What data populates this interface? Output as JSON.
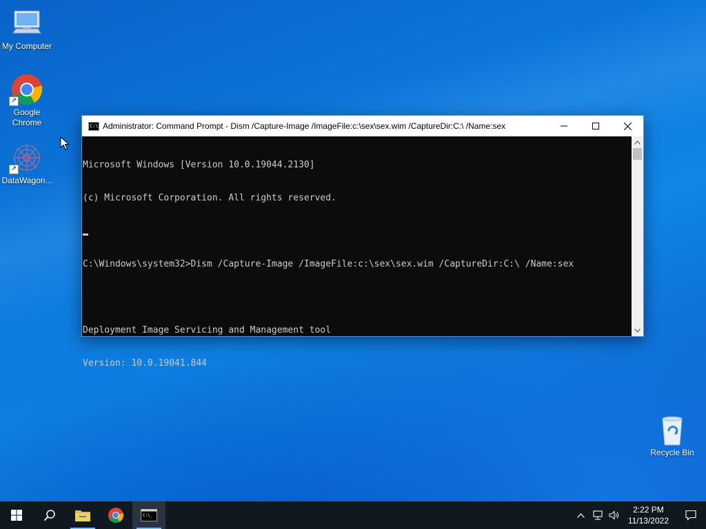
{
  "desktop": {
    "icons": [
      {
        "label": "My Computer",
        "icon": "computer-icon"
      },
      {
        "label": "Google Chrome",
        "icon": "chrome-icon"
      },
      {
        "label": "DataWagon...",
        "icon": "datawagon-icon"
      },
      {
        "label": "Recycle Bin",
        "icon": "recycle-bin-icon"
      }
    ]
  },
  "console_window": {
    "title": "Administrator: Command Prompt - Dism  /Capture-Image /ImageFile:c:\\sex\\sex.wim /CaptureDir:C:\\ /Name:sex",
    "icon": "cmd-icon",
    "lines": [
      "Microsoft Windows [Version 10.0.19044.2130]",
      "(c) Microsoft Corporation. All rights reserved.",
      "",
      "C:\\Windows\\system32>Dism /Capture-Image /ImageFile:c:\\sex\\sex.wim /CaptureDir:C:\\ /Name:sex",
      "",
      "Deployment Image Servicing and Management tool",
      "Version: 10.0.19041.844"
    ],
    "colors": {
      "background": "#0c0c0c",
      "text": "#cccccc"
    }
  },
  "taskbar": {
    "buttons": [
      "start-icon",
      "search-icon",
      "file-explorer-icon",
      "chrome-icon",
      "cmd-icon"
    ],
    "tray": {
      "time": "2:22 PM",
      "date": "11/13/2022"
    }
  },
  "colors": {
    "accent": "#0078d7",
    "taskbar": "#101820"
  }
}
